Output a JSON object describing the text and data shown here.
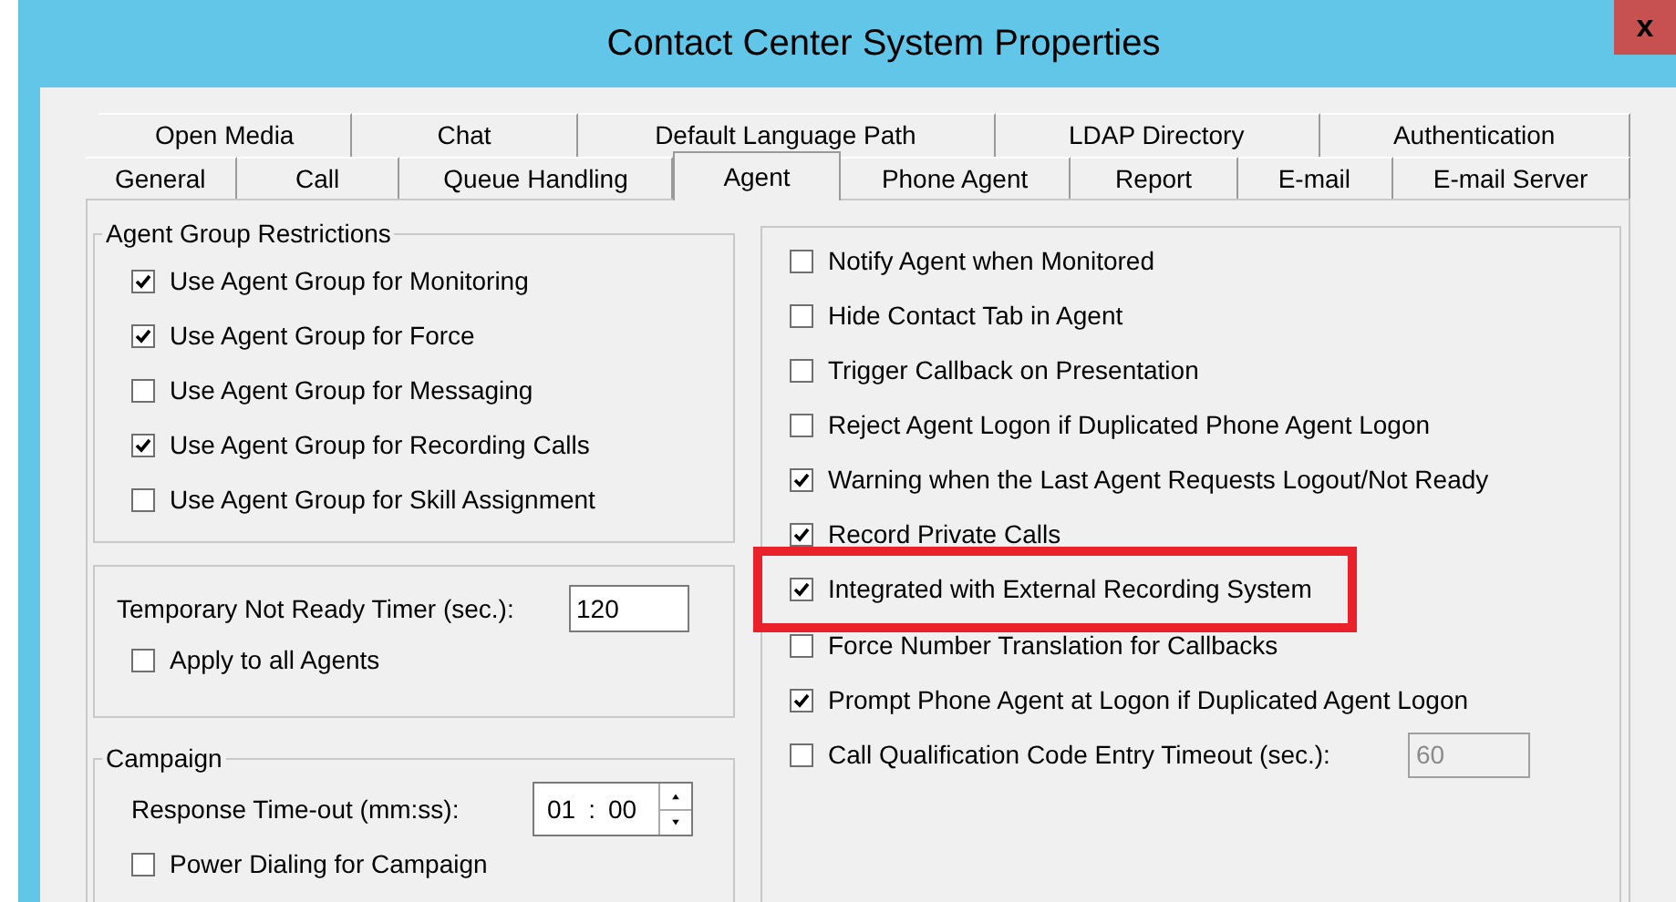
{
  "window": {
    "title": "Contact Center System Properties",
    "close_label": "x"
  },
  "tab_rows": [
    [
      {
        "label": "Open Media",
        "selected": false
      },
      {
        "label": "Chat",
        "selected": false
      },
      {
        "label": "Default Language Path",
        "selected": false
      },
      {
        "label": "LDAP Directory",
        "selected": false
      },
      {
        "label": "Authentication",
        "selected": false
      }
    ],
    [
      {
        "label": "General",
        "selected": false
      },
      {
        "label": "Call",
        "selected": false
      },
      {
        "label": "Queue Handling",
        "selected": false
      },
      {
        "label": "Agent",
        "selected": true
      },
      {
        "label": "Phone Agent",
        "selected": false
      },
      {
        "label": "Report",
        "selected": false
      },
      {
        "label": "E-mail",
        "selected": false
      },
      {
        "label": "E-mail Server",
        "selected": false
      }
    ]
  ],
  "agent_group_restrictions": {
    "title": "Agent Group Restrictions",
    "options": [
      {
        "label": "Use Agent Group for Monitoring",
        "checked": true
      },
      {
        "label": "Use Agent Group for Force",
        "checked": true
      },
      {
        "label": "Use Agent Group for Messaging",
        "checked": false
      },
      {
        "label": "Use Agent Group for Recording Calls",
        "checked": true
      },
      {
        "label": "Use Agent Group for Skill Assignment",
        "checked": false
      }
    ]
  },
  "not_ready_timer": {
    "label": "Temporary Not Ready Timer (sec.):",
    "value": "120",
    "apply_all": {
      "label": "Apply to all Agents",
      "checked": false
    }
  },
  "campaign": {
    "title": "Campaign",
    "timeout_label": "Response Time-out (mm:ss):",
    "minutes": "01",
    "separator": ":",
    "seconds": "00",
    "power_dialing": {
      "label": "Power Dialing for Campaign",
      "checked": false
    }
  },
  "agent_options": [
    {
      "label": "Notify Agent when Monitored",
      "checked": false,
      "highlighted": false
    },
    {
      "label": "Hide Contact Tab in Agent",
      "checked": false,
      "highlighted": false
    },
    {
      "label": "Trigger Callback on Presentation",
      "checked": false,
      "highlighted": false
    },
    {
      "label": "Reject Agent Logon if Duplicated Phone Agent Logon",
      "checked": false,
      "highlighted": false
    },
    {
      "label": "Warning when the Last Agent Requests Logout/Not Ready",
      "checked": true,
      "highlighted": false
    },
    {
      "label": "Record Private Calls",
      "checked": true,
      "highlighted": false
    },
    {
      "label": "Integrated with External Recording System",
      "checked": true,
      "highlighted": true
    },
    {
      "label": "Force Number Translation for Callbacks",
      "checked": false,
      "highlighted": false
    },
    {
      "label": "Prompt Phone Agent at Logon if Duplicated Agent Logon",
      "checked": true,
      "highlighted": false
    },
    {
      "label": "Call Qualification Code Entry Timeout (sec.):",
      "checked": false,
      "highlighted": false,
      "value": "60"
    }
  ]
}
